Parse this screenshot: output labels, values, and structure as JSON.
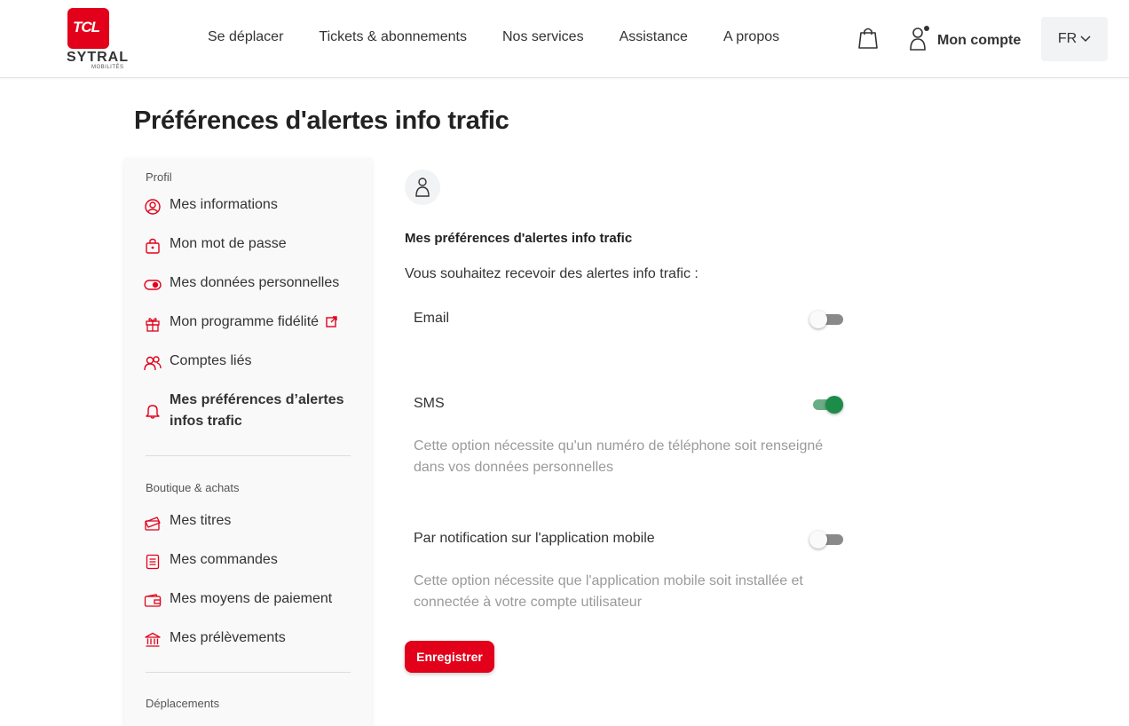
{
  "brand": {
    "logo_text": "TCL",
    "name": "SYTRAL",
    "tagline": "MOBILITÉS"
  },
  "nav": [
    {
      "label": "Se déplacer"
    },
    {
      "label": "Tickets & abonnements"
    },
    {
      "label": "Nos services"
    },
    {
      "label": "Assistance"
    },
    {
      "label": "A propos"
    }
  ],
  "header": {
    "account_label": "Mon compte",
    "lang": "FR"
  },
  "page_title": "Préférences d'alertes info trafic",
  "sidebar": {
    "sections": [
      {
        "label": "Profil"
      },
      {
        "label": "Boutique & achats"
      },
      {
        "label": "Déplacements"
      }
    ],
    "profile_items": [
      {
        "label": "Mes informations",
        "icon": "user-circle-icon"
      },
      {
        "label": "Mon mot de passe",
        "icon": "lock-icon"
      },
      {
        "label": "Mes données personnelles",
        "icon": "toggle-icon"
      },
      {
        "label": "Mon programme fidélité",
        "icon": "gift-icon"
      },
      {
        "label": "Comptes liés",
        "icon": "users-icon"
      },
      {
        "label": "Mes préférences d’alertes infos trafic",
        "icon": "bell-icon",
        "active": true
      }
    ],
    "shop_items": [
      {
        "label": "Mes titres",
        "icon": "ticket-icon"
      },
      {
        "label": "Mes commandes",
        "icon": "list-icon"
      },
      {
        "label": "Mes moyens de paiement",
        "icon": "wallet-icon"
      },
      {
        "label": "Mes prélèvements",
        "icon": "bank-icon"
      }
    ]
  },
  "main": {
    "heading": "Mes préférences d'alertes info trafic",
    "intro": "Vous souhaitez recevoir des alertes info trafic :",
    "options": [
      {
        "label": "Email",
        "enabled": false,
        "note": ""
      },
      {
        "label": "SMS",
        "enabled": true,
        "note": "Cette option nécessite qu'un numéro de téléphone soit renseigné dans vos données personnelles"
      },
      {
        "label": "Par notification sur l'application mobile",
        "enabled": false,
        "note": "Cette option nécessite que l'application mobile soit installée et connectée à votre compte utilisateur"
      }
    ],
    "save_label": "Enregistrer"
  },
  "colors": {
    "accent": "#e2001a",
    "toggle_on": "#1e8c49",
    "toggle_off": "#8a8a8a"
  }
}
